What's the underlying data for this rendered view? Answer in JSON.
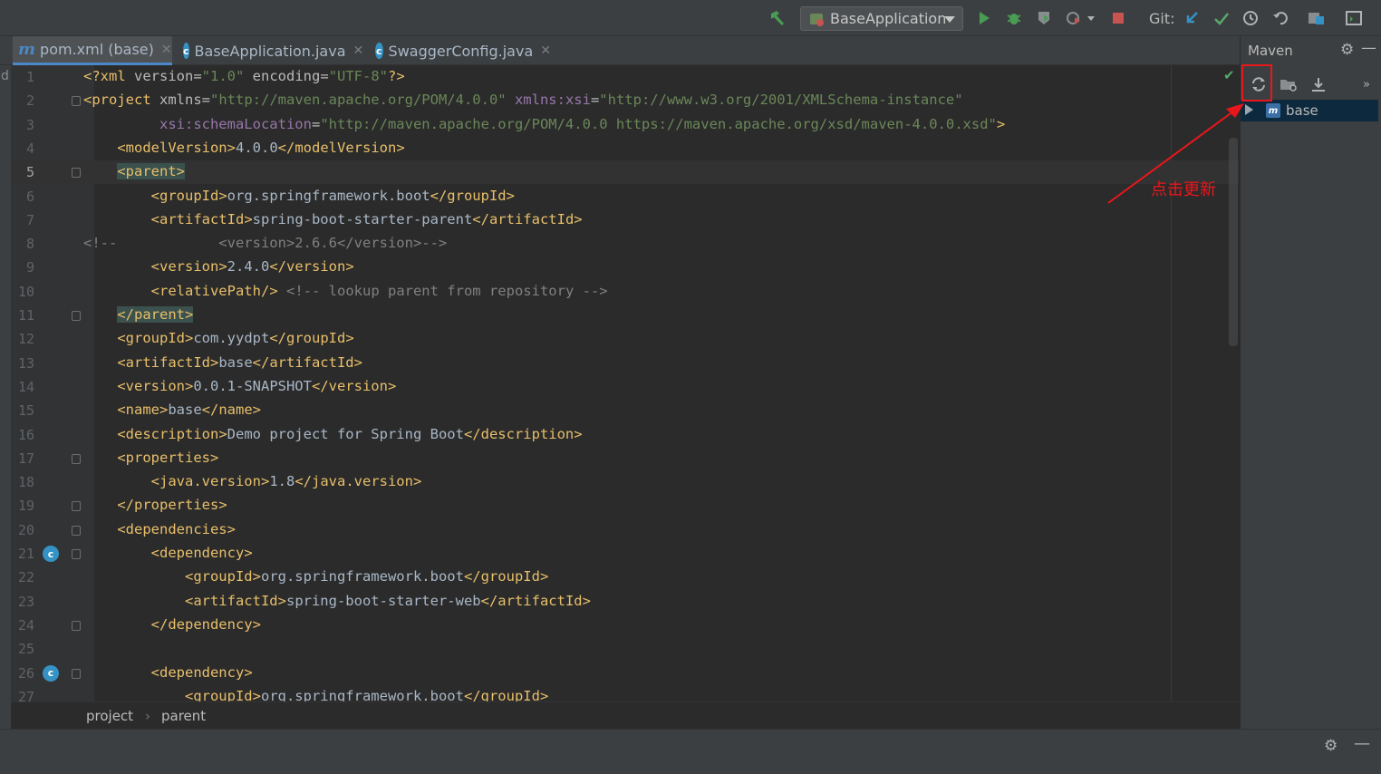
{
  "toolbar": {
    "run_config": "BaseApplication",
    "git_label": "Git:",
    "colors": {
      "run": "#499c54",
      "stop": "#c75450",
      "vcs_update": "#3592c4",
      "vcs_commit": "#59a869"
    }
  },
  "tabs": [
    {
      "label": "pom.xml (base)",
      "icon": "maven-icon",
      "active": true
    },
    {
      "label": "BaseApplication.java",
      "icon": "spring-boot-class-icon",
      "active": false
    },
    {
      "label": "SwaggerConfig.java",
      "icon": "class-icon",
      "active": false
    }
  ],
  "left_strip": {
    "label": "d"
  },
  "editor": {
    "current_line": 5,
    "lines": [
      {
        "n": "1",
        "code": "<?xml version=\"1.0\" encoding=\"UTF-8\"?>"
      },
      {
        "n": "2",
        "code": "<project xmlns=\"http://maven.apache.org/POM/4.0.0\" xmlns:xsi=\"http://www.w3.org/2001/XMLSchema-instance\""
      },
      {
        "n": "3",
        "code": "         xsi:schemaLocation=\"http://maven.apache.org/POM/4.0.0 https://maven.apache.org/xsd/maven-4.0.0.xsd\">"
      },
      {
        "n": "4",
        "code": "    <modelVersion>4.0.0</modelVersion>"
      },
      {
        "n": "5",
        "code": "    <parent>"
      },
      {
        "n": "6",
        "code": "        <groupId>org.springframework.boot</groupId>"
      },
      {
        "n": "7",
        "code": "        <artifactId>spring-boot-starter-parent</artifactId>"
      },
      {
        "n": "8",
        "code": "<!--            <version>2.6.6</version>-->"
      },
      {
        "n": "9",
        "code": "        <version>2.4.0</version>"
      },
      {
        "n": "10",
        "code": "        <relativePath/> <!-- lookup parent from repository -->"
      },
      {
        "n": "11",
        "code": "    </parent>"
      },
      {
        "n": "12",
        "code": "    <groupId>com.yydpt</groupId>"
      },
      {
        "n": "13",
        "code": "    <artifactId>base</artifactId>"
      },
      {
        "n": "14",
        "code": "    <version>0.0.1-SNAPSHOT</version>"
      },
      {
        "n": "15",
        "code": "    <name>base</name>"
      },
      {
        "n": "16",
        "code": "    <description>Demo project for Spring Boot</description>"
      },
      {
        "n": "17",
        "code": "    <properties>"
      },
      {
        "n": "18",
        "code": "        <java.version>1.8</java.version>"
      },
      {
        "n": "19",
        "code": "    </properties>"
      },
      {
        "n": "20",
        "code": "    <dependencies>"
      },
      {
        "n": "21",
        "code": "        <dependency>"
      },
      {
        "n": "22",
        "code": "            <groupId>org.springframework.boot</groupId>"
      },
      {
        "n": "23",
        "code": "            <artifactId>spring-boot-starter-web</artifactId>"
      },
      {
        "n": "24",
        "code": "        </dependency>"
      },
      {
        "n": "25",
        "code": ""
      },
      {
        "n": "26",
        "code": "        <dependency>"
      },
      {
        "n": "27",
        "code": "            <groupId>org.springframework.boot</groupId>"
      }
    ]
  },
  "breadcrumb": {
    "items": [
      "project",
      "parent"
    ],
    "separator": "›"
  },
  "maven": {
    "title": "Maven",
    "tree": {
      "label": "base"
    },
    "tools": [
      "reload-icon",
      "add-maven-project-icon",
      "download-sources-icon",
      "more-icon"
    ]
  },
  "annotation": {
    "text": "点击更新",
    "color": "#e8171c"
  }
}
